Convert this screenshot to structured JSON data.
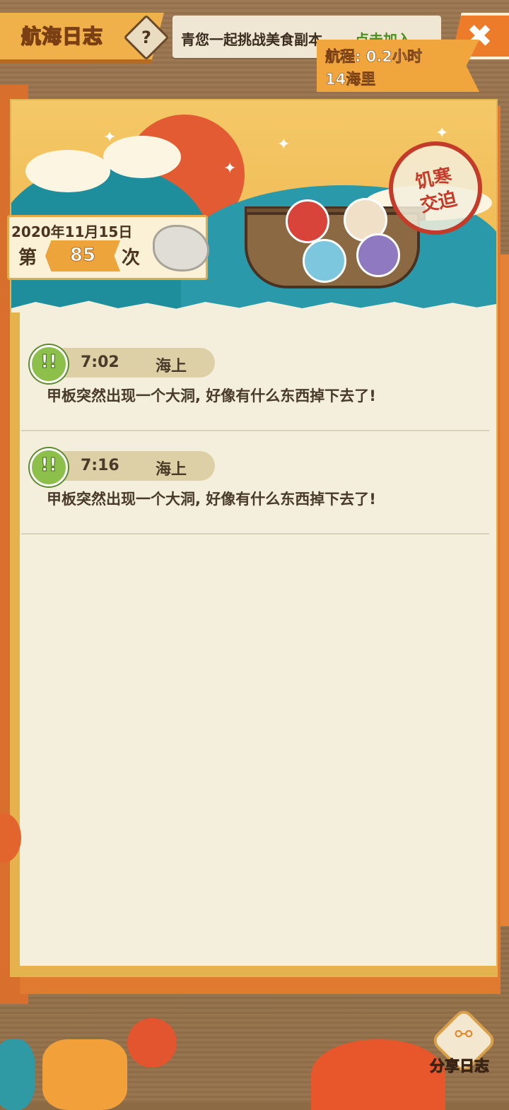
{
  "header": {
    "title": "航海日志",
    "help_label": "?",
    "invite_text": "青您一起挑战美食副本,",
    "invite_link": "点击加入",
    "close_label": "✖"
  },
  "voyage": {
    "distance_line1": "航程: 0.2小时",
    "distance_line2": "14海里",
    "date": "2020年11月15日",
    "count_prefix": "第",
    "count_value": "85",
    "count_suffix": "次",
    "stamp_line1": "饥寒",
    "stamp_line2": "交迫"
  },
  "entries": [
    {
      "time": "7:02",
      "location": "海上",
      "text": "甲板突然出现一个大洞, 好像有什么东西掉下去了!",
      "icon": "double-exclaim-icon"
    },
    {
      "time": "7:16",
      "location": "海上",
      "text": "甲板突然出现一个大洞, 好像有什么东西掉下去了!",
      "icon": "double-exclaim-icon"
    }
  ],
  "share": {
    "label": "分享日志",
    "icon": "share-icon"
  },
  "colors": {
    "accent_orange": "#ec7b2a",
    "panel_bg": "#f3efdc",
    "link_green": "#4a8f1f",
    "stamp_red": "#c43b2a"
  }
}
